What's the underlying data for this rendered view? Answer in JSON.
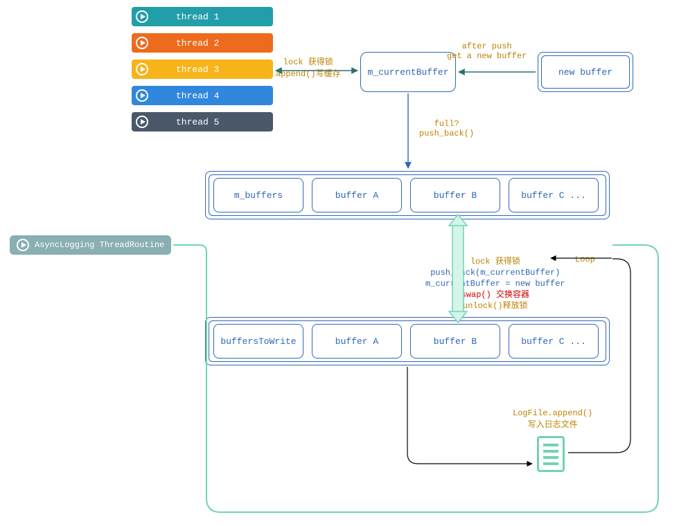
{
  "threads": [
    {
      "label": "thread 1",
      "color": "#229ea9"
    },
    {
      "label": "thread 2",
      "color": "#ed6b1c"
    },
    {
      "label": "thread 3",
      "color": "#f7b31a"
    },
    {
      "label": "thread 4",
      "color": "#3187dc"
    },
    {
      "label": "thread 5",
      "color": "#4a5869"
    }
  ],
  "currentBuffer": "m_currentBuffer",
  "newBuffer": "new buffer",
  "lockLabel": {
    "l1": "lock 获得锁",
    "l2": "append()写缓存"
  },
  "afterPush": {
    "l1": "after push",
    "l2": "get a new buffer"
  },
  "fullLabel": {
    "l1": "full?",
    "l2": "push_back()"
  },
  "buffersRow": {
    "head": "m_buffers",
    "cells": [
      "buffer A",
      "buffer B",
      "buffer C ..."
    ]
  },
  "routine": "AsyncLogging ThreadRoutine",
  "loop": "Loop",
  "swapBlock": {
    "l1": "lock 获得锁",
    "l2": "push_back(m_currentBuffer)",
    "l3": "m_currentBuffer = new buffer",
    "l4": "swap() 交换容器",
    "l5": "unlock()释放锁"
  },
  "writeRow": {
    "head": "buffersToWrite",
    "cells": [
      "buffer A",
      "buffer B",
      "buffer C ..."
    ]
  },
  "logAppend": {
    "l1": "LogFile.append()",
    "l2": "写入日志文件"
  }
}
